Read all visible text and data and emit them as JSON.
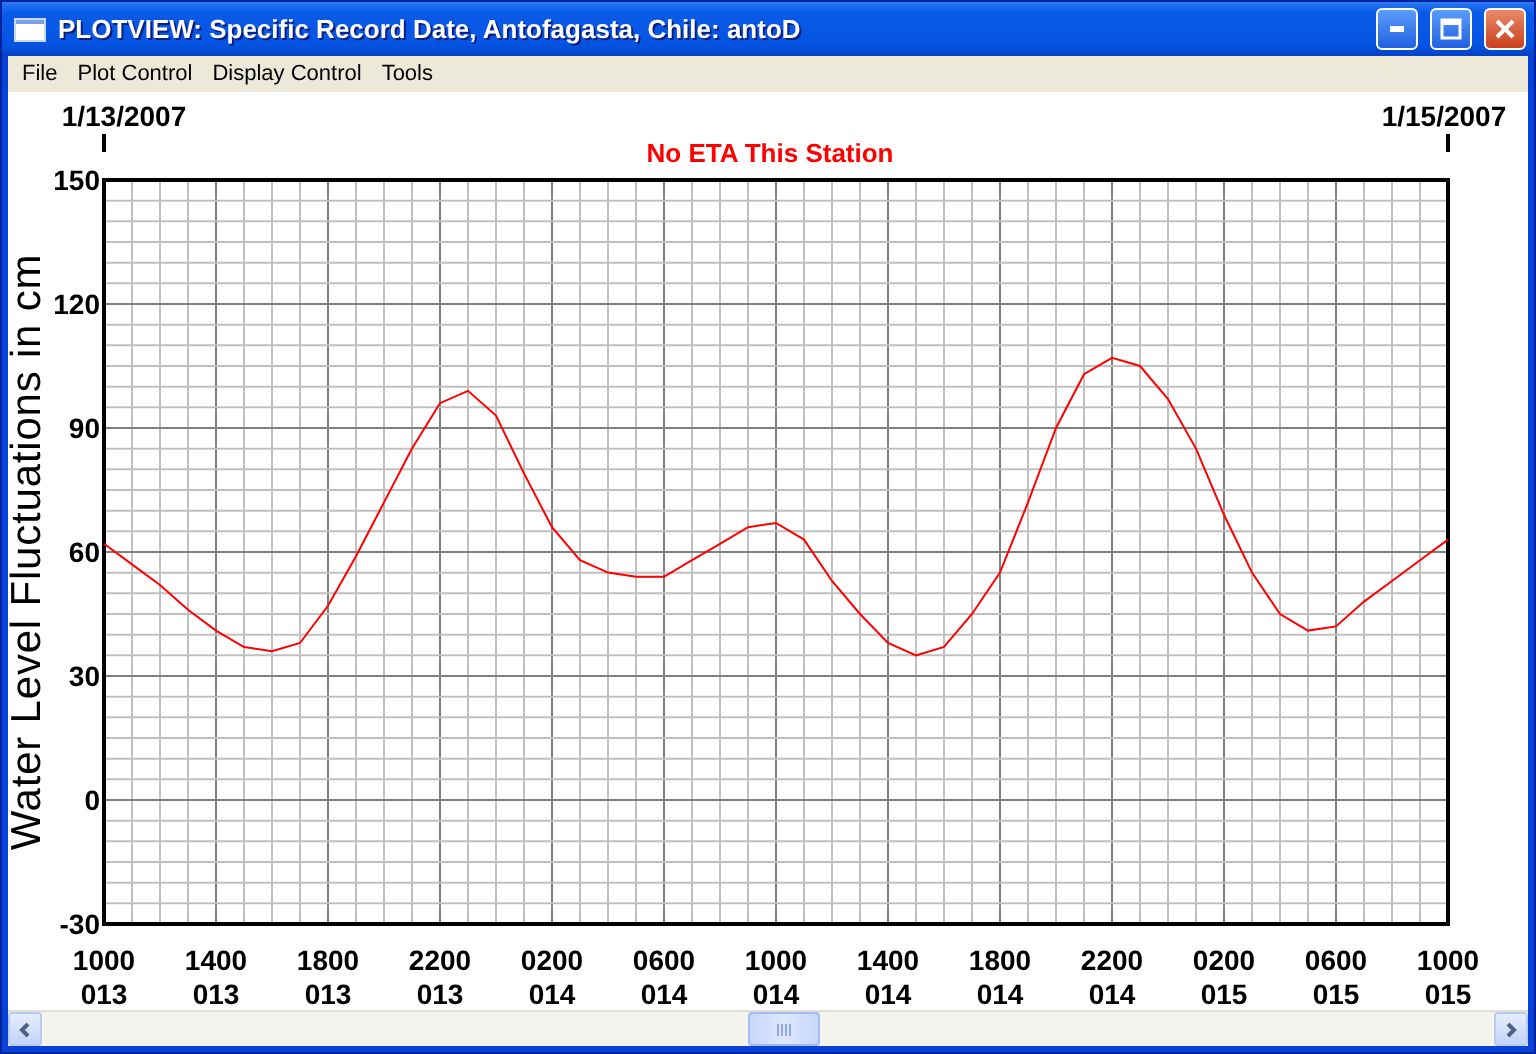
{
  "window": {
    "title": "PLOTVIEW: Specific Record Date, Antofagasta, Chile: antoD"
  },
  "menu": [
    "File",
    "Plot Control",
    "Display Control",
    "Tools"
  ],
  "plot": {
    "start_date": "1/13/2007",
    "end_date": "1/15/2007",
    "message": "No ETA This Station",
    "chart_data": {
      "type": "line",
      "ylabel": "Water Level Fluctuations in cm",
      "ylim": [
        -30,
        150
      ],
      "grid": true,
      "yticks": [
        -30,
        0,
        30,
        60,
        90,
        120,
        150
      ],
      "categories": [
        "1000 013",
        null,
        null,
        null,
        "1400 013",
        null,
        null,
        null,
        "1800 013",
        null,
        null,
        null,
        "2200 013",
        null,
        null,
        null,
        "0200 014",
        null,
        null,
        null,
        "0600 014",
        null,
        null,
        null,
        "1000 014",
        null,
        null,
        null,
        "1400 014",
        null,
        null,
        null,
        "1800 014",
        null,
        null,
        null,
        "2200 014",
        null,
        null,
        null,
        "0200 015",
        null,
        null,
        null,
        "0600 015",
        null,
        null,
        null,
        "1000 015"
      ],
      "series": [
        {
          "color": "#ff0000",
          "values": [
            62,
            57,
            52,
            46,
            41,
            37,
            36,
            38,
            47,
            59,
            72,
            85,
            96,
            99,
            93,
            79,
            66,
            58,
            55,
            54,
            54,
            58,
            62,
            66,
            67,
            63,
            53,
            45,
            38,
            35,
            37,
            45,
            55,
            72,
            90,
            103,
            107,
            105,
            97,
            85,
            69,
            55,
            45,
            41,
            42,
            48,
            53,
            58,
            63
          ]
        }
      ]
    }
  }
}
